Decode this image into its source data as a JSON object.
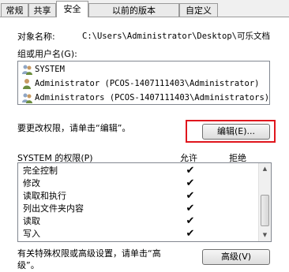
{
  "tabs": [
    {
      "label": "常规"
    },
    {
      "label": "共享"
    },
    {
      "label": "安全"
    },
    {
      "label": "以前的版本"
    },
    {
      "label": "自定义"
    }
  ],
  "object_name_label": "对象名称:",
  "object_name_value": "C:\\Users\\Administrator\\Desktop\\可乐文档",
  "group_label": "组或用户名(G):",
  "groups": [
    {
      "name": "SYSTEM",
      "icon": "group-icon"
    },
    {
      "name": "Administrator (PCOS-1407111403\\Administrator)",
      "icon": "user-icon"
    },
    {
      "name": "Administrators (PCOS-1407111403\\Administrators)",
      "icon": "group-icon"
    }
  ],
  "change_hint": "要更改权限，请单击“编辑”。",
  "edit_button": "编辑(E)...",
  "perm_label": "SYSTEM 的权限(P)",
  "allow_label": "允许",
  "deny_label": "拒绝",
  "permissions": [
    {
      "name": "完全控制",
      "allow": "✔",
      "deny": ""
    },
    {
      "name": "修改",
      "allow": "✔",
      "deny": ""
    },
    {
      "name": "读取和执行",
      "allow": "✔",
      "deny": ""
    },
    {
      "name": "列出文件夹内容",
      "allow": "✔",
      "deny": ""
    },
    {
      "name": "读取",
      "allow": "✔",
      "deny": ""
    },
    {
      "name": "写入",
      "allow": "✔",
      "deny": ""
    }
  ],
  "advanced_hint_line1": "有关特殊权限或高级设置，请单击“高",
  "advanced_hint_line2": "级”。",
  "advanced_button": "高级(V)",
  "colors": {
    "highlight_box": "#e0161d"
  }
}
